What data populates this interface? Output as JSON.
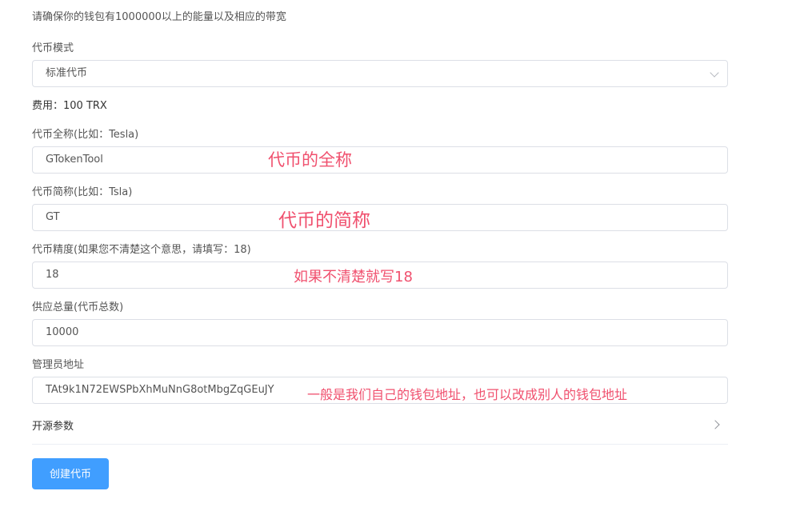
{
  "notice": "请确保你的钱包有1000000以上的能量以及相应的带宽",
  "mode": {
    "label": "代币模式",
    "value": "标准代币",
    "icon": "chevron-down-icon"
  },
  "fee": "费用：100 TRX",
  "full_name": {
    "label": "代币全称(比如：Tesla)",
    "value": "GTokenTool",
    "annotation": "代币的全称"
  },
  "symbol": {
    "label": "代币简称(比如：Tsla)",
    "value": "GT",
    "annotation": "代币的简称"
  },
  "decimals": {
    "label": "代币精度(如果您不清楚这个意思，请填写：18)",
    "value": "18",
    "annotation": "如果不清楚就写18"
  },
  "supply": {
    "label": "供应总量(代币总数)",
    "value": "10000"
  },
  "owner": {
    "label": "管理员地址",
    "value": "TAt9k1N72EWSPbXhMuNnG8otMbgZqGEuJY",
    "annotation": "一般是我们自己的钱包地址，也可以改成别人的钱包地址"
  },
  "advanced": {
    "label": "开源参数",
    "icon": "chevron-right-icon"
  },
  "submit_label": "创建代币",
  "colors": {
    "primary": "#409eff",
    "annotation": "#f0506e",
    "border": "#dcdfe6"
  }
}
